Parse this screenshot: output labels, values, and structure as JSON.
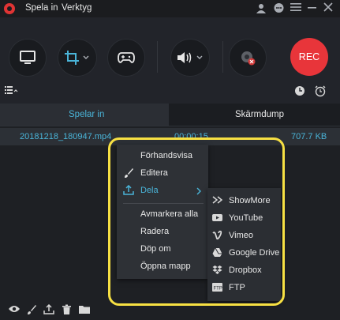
{
  "titlebar": {
    "menu": [
      "Spela in",
      "Verktyg"
    ]
  },
  "toolbar": {
    "rec_label": "REC"
  },
  "tabs": [
    "Spelar in",
    "Skärmdump"
  ],
  "recordings": [
    {
      "name": "20181218_180947.mp4",
      "duration": "00:00:15",
      "size": "707.7 KB"
    }
  ],
  "context_menu": {
    "items": [
      "Förhandsvisa",
      "Editera",
      "Dela",
      "Avmarkera alla",
      "Radera",
      "Döp om",
      "Öppna mapp"
    ]
  },
  "share_submenu": {
    "items": [
      "ShowMore",
      "YouTube",
      "Vimeo",
      "Google Drive",
      "Dropbox",
      "FTP"
    ]
  },
  "colors": {
    "accent": "#4ab4d8",
    "rec": "#e8353a",
    "highlight": "#f7e043"
  }
}
